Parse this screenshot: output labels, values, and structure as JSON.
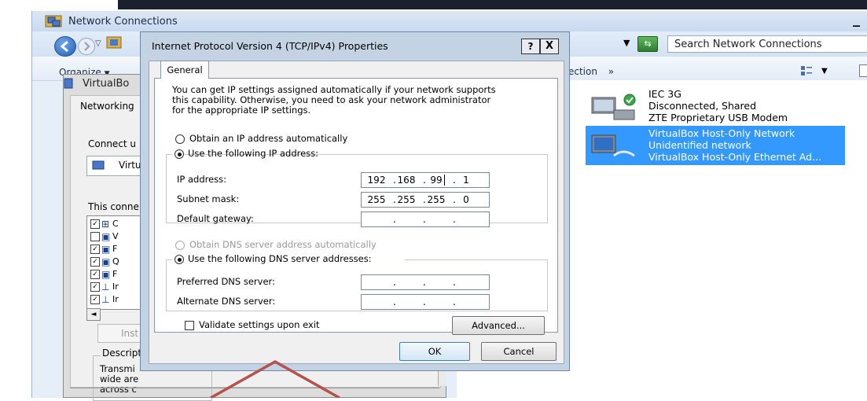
{
  "colors": {
    "selection": "#3399ff",
    "annotation": "#b5524b",
    "dialog_frame": "#c4d3e4"
  },
  "network_window": {
    "title": "Network Connections",
    "search_placeholder": "Search Network Connections",
    "organize_label": "Organize",
    "command_label": "ection",
    "command_more": "»",
    "items": [
      {
        "name": "IEC 3G",
        "status": "Disconnected, Shared",
        "device": "ZTE Proprietary USB Modem",
        "selected": false
      },
      {
        "name": "VirtualBox Host-Only Network",
        "status": "Unidentified network",
        "device": "VirtualBox Host-Only Ethernet Ad...",
        "selected": true
      }
    ]
  },
  "vbox_window": {
    "title": "VirtualBo",
    "tab": "Networking",
    "connect_using": "Connect u",
    "adapter": "Virtu",
    "this_connection": "This conne",
    "components": [
      {
        "checked": true,
        "letter": "C",
        "icon": "client-icon"
      },
      {
        "checked": false,
        "letter": "V",
        "icon": "service-icon"
      },
      {
        "checked": true,
        "letter": "F",
        "icon": "service-icon"
      },
      {
        "checked": true,
        "letter": "Q",
        "icon": "service-icon"
      },
      {
        "checked": true,
        "letter": "F",
        "icon": "service-icon"
      },
      {
        "checked": true,
        "letter": "Ir",
        "icon": "protocol-icon"
      },
      {
        "checked": true,
        "letter": "Ir",
        "icon": "protocol-icon"
      }
    ],
    "install_label": "Inst",
    "description_label": "Descripti",
    "description_lines": [
      "Transmi",
      "wide are",
      "across c"
    ]
  },
  "dialog": {
    "title": "Internet Protocol Version 4 (TCP/IPv4) Properties",
    "help_label": "?",
    "close_label": "X",
    "tab_general": "General",
    "intro_lines": [
      "You can get IP settings assigned automatically if your network supports",
      "this capability. Otherwise, you need to ask your network administrator",
      "for the appropriate IP settings."
    ],
    "obtain_ip_auto": "Obtain an IP address automatically",
    "use_following_ip": "Use the following IP address:",
    "ip_address_label": "IP address:",
    "ip_address": [
      "192",
      "168",
      "99",
      "1"
    ],
    "subnet_mask_label": "Subnet mask:",
    "subnet_mask": [
      "255",
      "255",
      "255",
      "0"
    ],
    "default_gateway_label": "Default gateway:",
    "obtain_dns_auto": "Obtain DNS server address automatically",
    "use_following_dns": "Use the following DNS server addresses:",
    "preferred_dns_label": "Preferred DNS server:",
    "alternate_dns_label": "Alternate DNS server:",
    "validate_label": "Validate settings upon exit",
    "advanced_label": "Advanced...",
    "ok_label": "OK",
    "cancel_label": "Cancel"
  }
}
